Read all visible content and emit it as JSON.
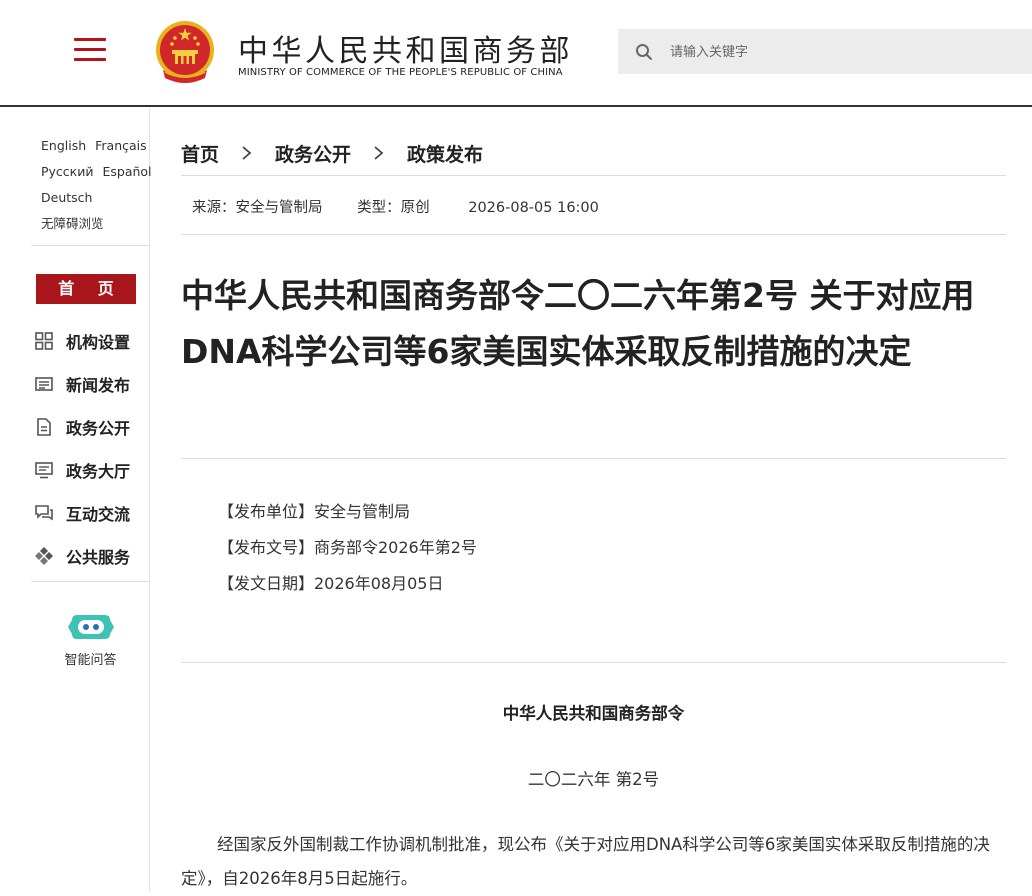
{
  "header": {
    "site_title": "中华人民共和国商务部",
    "site_subtitle": "MINISTRY OF COMMERCE OF THE PEOPLE'S REPUBLIC OF CHINA",
    "search_placeholder": "请输入关键字",
    "menu_icon": "hamburger-icon",
    "search_icon": "search-icon",
    "brand_color": "#b3141c"
  },
  "sidebar": {
    "languages": [
      "English",
      "Français",
      "Русский",
      "Español",
      "Deutsch"
    ],
    "accessibility": "无障碍浏览",
    "home_label": "首 页",
    "home_color": "#a8151b",
    "nav_items": [
      {
        "label": "机构设置",
        "icon": "grid-icon"
      },
      {
        "label": "新闻发布",
        "icon": "news-icon"
      },
      {
        "label": "政务公开",
        "icon": "document-icon"
      },
      {
        "label": "政务大厅",
        "icon": "monitor-icon"
      },
      {
        "label": "互动交流",
        "icon": "chat-icon"
      },
      {
        "label": "公共服务",
        "icon": "service-icon"
      }
    ],
    "ai_label": "智能问答",
    "ai_icon": "robot-icon",
    "ai_color": "#3cc3b4"
  },
  "breadcrumb": [
    "首页",
    "政务公开",
    "政策发布"
  ],
  "meta": {
    "source": "来源：安全与管制局",
    "type": "类型：原创",
    "datetime": "2026-08-05 16:00"
  },
  "article": {
    "title": "中华人民共和国商务部令二〇二六年第2号 关于对应用DNA科学公司等6家美国实体采取反制措施的决定",
    "info": [
      "【发布单位】安全与管制局",
      "【发布文号】商务部令2026年第2号",
      "【发文日期】2026年08月05日"
    ],
    "doc_heading": "中华人民共和国商务部令",
    "doc_number": "二〇二六年 第2号",
    "body": "经国家反外国制裁工作协调机制批准，现公布《关于对应用DNA科学公司等6家美国实体采取反制措施的决定》，自2026年8月5日起施行。"
  }
}
